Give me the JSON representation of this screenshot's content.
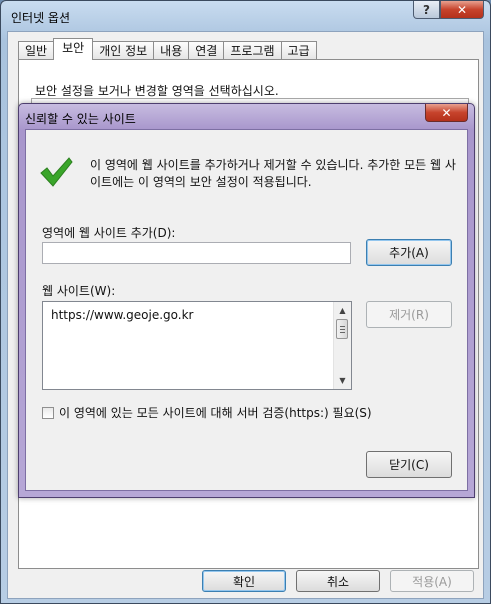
{
  "outer": {
    "title": "인터넷 옵션",
    "help_label": "?",
    "close_label": "✕",
    "tabs": [
      {
        "label": "일반",
        "active": false
      },
      {
        "label": "보안",
        "active": true
      },
      {
        "label": "개인 정보",
        "active": false
      },
      {
        "label": "내용",
        "active": false
      },
      {
        "label": "연결",
        "active": false
      },
      {
        "label": "프로그램",
        "active": false
      },
      {
        "label": "고급",
        "active": false
      }
    ],
    "security_instruction": "보안 설정을 보거나 변경할 영역을 선택하십시오.",
    "buttons": {
      "ok": "확인",
      "cancel": "취소",
      "apply": "적용(A)"
    }
  },
  "trusted_sites": {
    "title": "신뢰할 수 있는 사이트",
    "close_label": "✕",
    "info_text": "이 영역에 웹 사이트를 추가하거나 제거할 수 있습니다. 추가한 모든 웹 사이트에는 이 영역의 보안 설정이 적용됩니다.",
    "add_label": "영역에 웹 사이트 추가(D):",
    "add_value": "",
    "add_button": "추가(A)",
    "websites_label": "웹 사이트(W):",
    "websites": [
      "https://www.geoje.go.kr"
    ],
    "remove_button": "제거(R)",
    "https_label": "이 영역에 있는 모든 사이트에 대해 서버 검증(https:) 필요(S)",
    "https_checked": false,
    "close_button": "닫기(C)"
  },
  "colors": {
    "check_green": "#3aa52a",
    "close_red": "#c7432c"
  }
}
